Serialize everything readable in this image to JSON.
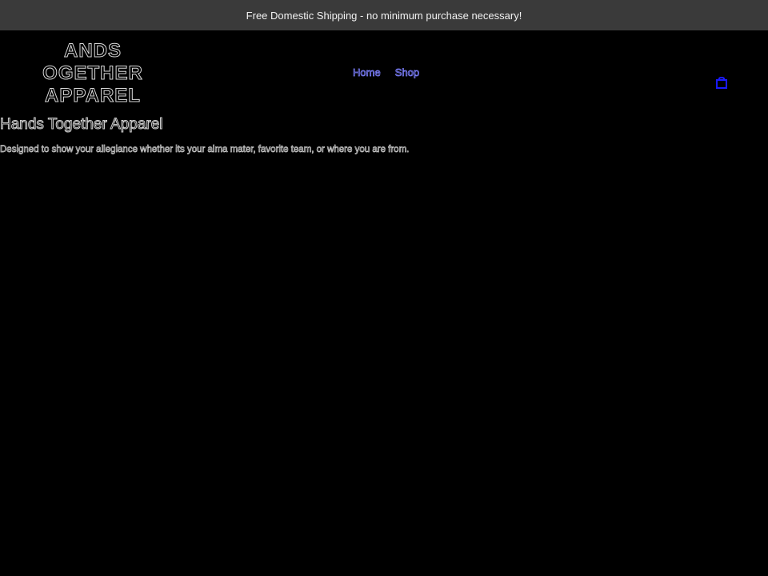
{
  "announcement": {
    "text": "Free Domestic Shipping - no minimum purchase necessary!"
  },
  "logo": {
    "line1": "ANDS",
    "line2": "OGETHER",
    "line3": "APPAREL"
  },
  "nav": {
    "items": [
      {
        "label": "Home"
      },
      {
        "label": "Shop"
      }
    ]
  },
  "cart": {
    "icon": "shopping-bag-icon",
    "color": "#1a1aff"
  },
  "main": {
    "heading": "Hands Together Apparel",
    "tagline": "Designed to show your allegiance whether its your alma mater, favorite team, or where you are from."
  },
  "colors": {
    "background": "#000000",
    "announcement_bar": "#3a3a3a",
    "nav_link": "#7d80ff"
  }
}
